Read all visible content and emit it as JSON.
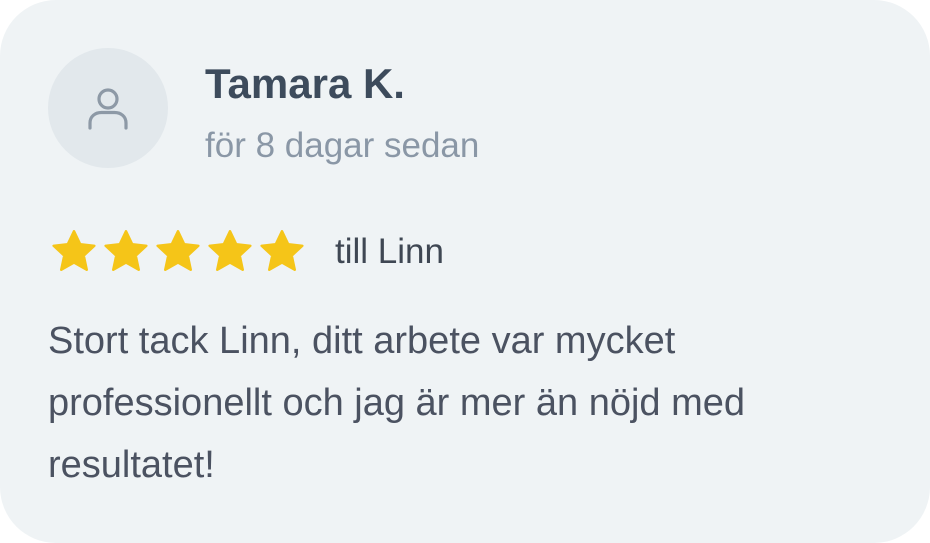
{
  "review": {
    "author_name": "Tamara K.",
    "time_ago": "för 8 dagar sedan",
    "avatar_icon": "user-icon",
    "rating": 5,
    "rating_max": 5,
    "star_icon": "star-icon",
    "recipient": "till Linn",
    "text": "Stort tack Linn, ditt arbete var mycket professionellt och jag är mer än nöjd med resultatet!"
  },
  "colors": {
    "card_background": "#eff3f5",
    "avatar_background": "#e2e8ec",
    "star": "#f5c518",
    "name_text": "#3d4b5c",
    "muted_text": "#8a97a6",
    "body_text": "#4b5261"
  }
}
